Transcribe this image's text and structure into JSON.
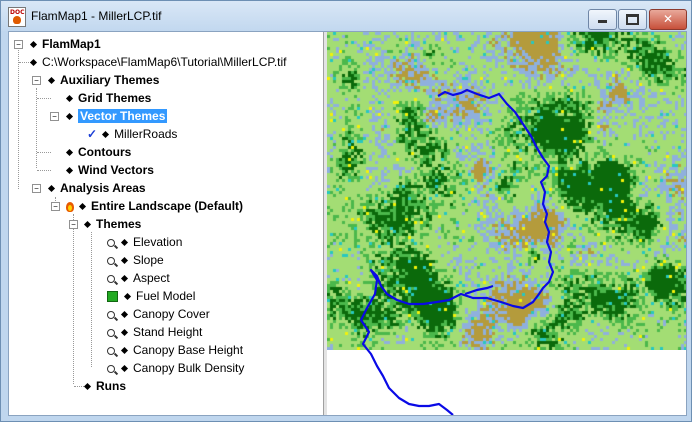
{
  "window": {
    "title": "FlamMap1 - MillerLCP.tif",
    "app_icon_text": "DOC"
  },
  "tree": {
    "root": "FlamMap1",
    "landscape_file": "C:\\Workspace\\FlamMap6\\Tutorial\\MillerLCP.tif",
    "auxiliary_themes": "Auxiliary Themes",
    "grid_themes": "Grid Themes",
    "vector_themes": "Vector Themes",
    "miller_roads": "MillerRoads",
    "contours": "Contours",
    "wind_vectors": "Wind Vectors",
    "analysis_areas": "Analysis Areas",
    "entire_landscape": "Entire Landscape (Default)",
    "themes": "Themes",
    "theme_items": [
      "Elevation",
      "Slope",
      "Aspect",
      "Fuel Model",
      "Canopy Cover",
      "Stand Height",
      "Canopy Base Height",
      "Canopy Bulk Density"
    ],
    "runs": "Runs"
  },
  "map": {
    "colors": {
      "light_green": "#a3dd74",
      "dark_green": "#0b6a0b",
      "medium_green": "#4bb84b",
      "blue_grey": "#8fb0dd",
      "brown": "#b49b3c",
      "yellow": "#f2f20a",
      "teal": "#27c8c0",
      "road": "#0a0ae6"
    }
  }
}
